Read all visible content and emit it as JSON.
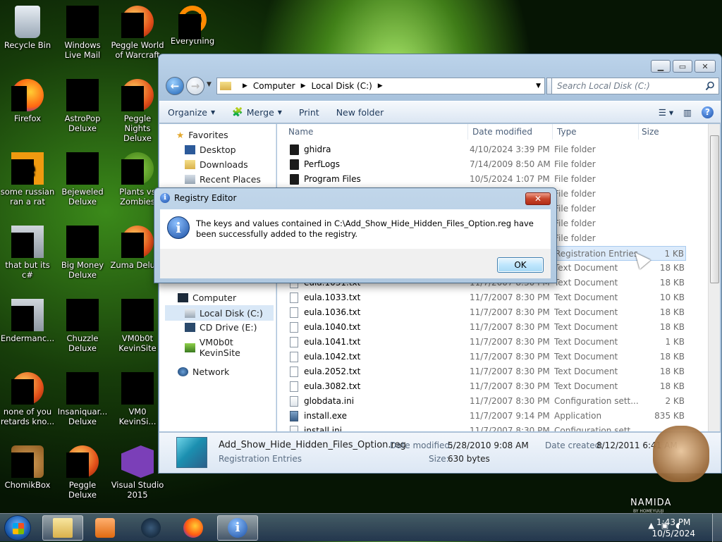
{
  "desktop": {
    "icons": [
      {
        "label": "Recycle Bin",
        "icon": "recycle-bin-icon"
      },
      {
        "label": "Windows Live Mail",
        "icon": "windows-live-mail-icon"
      },
      {
        "label": "Peggle World of Warcraft",
        "icon": "peggle-wow-icon"
      },
      {
        "label": "Everything",
        "icon": "everything-icon"
      },
      {
        "label": "Firefox",
        "icon": "firefox-icon"
      },
      {
        "label": "AstroPop Deluxe",
        "icon": "astropop-icon"
      },
      {
        "label": "Peggle Nights Deluxe",
        "icon": "peggle-nights-icon"
      },
      {
        "label": "some russian ran a rat",
        "icon": "e-app-icon"
      },
      {
        "label": "Bejeweled Deluxe",
        "icon": "bejeweled-icon"
      },
      {
        "label": "Plants vs Zombies",
        "icon": "plants-vs-zombies-icon"
      },
      {
        "label": "that but its c#",
        "icon": "windows-stack-icon"
      },
      {
        "label": "Big Money Deluxe",
        "icon": "big-money-icon"
      },
      {
        "label": "Zuma Deluxe",
        "icon": "zuma-icon"
      },
      {
        "label": "Endermanc...",
        "icon": "window-app-icon"
      },
      {
        "label": "Chuzzle Deluxe",
        "icon": "chuzzle-icon"
      },
      {
        "label": "VM0b0t KevinSite",
        "icon": "vm-globe-icon"
      },
      {
        "label": "none of you retards kno...",
        "icon": "red-ball-icon"
      },
      {
        "label": "Insaniquar... Deluxe",
        "icon": "insaniquarium-icon"
      },
      {
        "label": "VM0 KevinSi...",
        "icon": "vm-folder-icon"
      },
      {
        "label": "ChomikBox",
        "icon": "chomikbox-icon"
      },
      {
        "label": "Peggle Deluxe",
        "icon": "peggle-deluxe-icon"
      },
      {
        "label": "Visual Studio 2015",
        "icon": "visual-studio-icon"
      }
    ]
  },
  "explorer": {
    "address": {
      "seg1": "Computer",
      "seg2": "Local Disk (C:)"
    },
    "search_placeholder": "Search Local Disk (C:)",
    "toolbar": {
      "organize": "Organize",
      "merge": "Merge",
      "print": "Print",
      "new_folder": "New folder"
    },
    "nav": {
      "favorites": "Favorites",
      "desktop": "Desktop",
      "downloads": "Downloads",
      "recent": "Recent Places",
      "computer": "Computer",
      "local_disk": "Local Disk (C:)",
      "cd_drive": "CD Drive (E:)",
      "vm": "VM0b0t KevinSite",
      "network": "Network"
    },
    "columns": {
      "name": "Name",
      "date": "Date modified",
      "type": "Type",
      "size": "Size"
    },
    "rows": [
      {
        "name": "ghidra",
        "date": "4/10/2024 3:39 PM",
        "type": "File folder",
        "size": "",
        "kind": "folder"
      },
      {
        "name": "PerfLogs",
        "date": "7/14/2009 8:50 AM",
        "type": "File folder",
        "size": "",
        "kind": "folder"
      },
      {
        "name": "Program Files",
        "date": "10/5/2024 1:07 PM",
        "type": "File folder",
        "size": "",
        "kind": "folder"
      },
      {
        "name": "",
        "date": "",
        "type": "File folder",
        "size": "",
        "kind": "folder"
      },
      {
        "name": "",
        "date": "",
        "type": "File folder",
        "size": "",
        "kind": "folder"
      },
      {
        "name": "",
        "date": "",
        "type": "File folder",
        "size": "",
        "kind": "folder"
      },
      {
        "name": "",
        "date": "",
        "type": "File folder",
        "size": "",
        "kind": "folder"
      },
      {
        "name": "",
        "date": "",
        "type": "Registration Entries",
        "size": "1 KB",
        "kind": "reg"
      },
      {
        "name": "",
        "date": "",
        "type": "Text Document",
        "size": "18 KB",
        "kind": "txt"
      },
      {
        "name": "eula.1031.txt",
        "date": "11/7/2007 8:30 PM",
        "type": "Text Document",
        "size": "18 KB",
        "kind": "txt"
      },
      {
        "name": "eula.1033.txt",
        "date": "11/7/2007 8:30 PM",
        "type": "Text Document",
        "size": "10 KB",
        "kind": "txt"
      },
      {
        "name": "eula.1036.txt",
        "date": "11/7/2007 8:30 PM",
        "type": "Text Document",
        "size": "18 KB",
        "kind": "txt"
      },
      {
        "name": "eula.1040.txt",
        "date": "11/7/2007 8:30 PM",
        "type": "Text Document",
        "size": "18 KB",
        "kind": "txt"
      },
      {
        "name": "eula.1041.txt",
        "date": "11/7/2007 8:30 PM",
        "type": "Text Document",
        "size": "1 KB",
        "kind": "txt"
      },
      {
        "name": "eula.1042.txt",
        "date": "11/7/2007 8:30 PM",
        "type": "Text Document",
        "size": "18 KB",
        "kind": "txt"
      },
      {
        "name": "eula.2052.txt",
        "date": "11/7/2007 8:30 PM",
        "type": "Text Document",
        "size": "18 KB",
        "kind": "txt"
      },
      {
        "name": "eula.3082.txt",
        "date": "11/7/2007 8:30 PM",
        "type": "Text Document",
        "size": "18 KB",
        "kind": "txt"
      },
      {
        "name": "globdata.ini",
        "date": "11/7/2007 8:30 PM",
        "type": "Configuration sett...",
        "size": "2 KB",
        "kind": "ini"
      },
      {
        "name": "install.exe",
        "date": "11/7/2007 9:14 PM",
        "type": "Application",
        "size": "835 KB",
        "kind": "exe"
      },
      {
        "name": "install.ini",
        "date": "11/7/2007 8:30 PM",
        "type": "Configuration sett...",
        "size": "",
        "kind": "ini"
      }
    ],
    "details": {
      "filename": "Add_Show_Hide_Hidden_Files_Option.reg",
      "filetype": "Registration Entries",
      "modified_label": "Date modified:",
      "modified_value": "5/28/2010 9:08 AM",
      "created_label": "Date created:",
      "created_value": "8/12/2011 6:41 AM",
      "size_label": "Size:",
      "size_value": "630 bytes"
    }
  },
  "dialog": {
    "title": "Registry Editor",
    "message": "The keys and values contained in C:\\Add_Show_Hide_Hidden_Files_Option.reg have been successfully added to the registry.",
    "ok": "OK",
    "close": "✕"
  },
  "taskbar": {
    "time": "1:43 PM",
    "date": "10/5/2024"
  },
  "watermark": {
    "brand": "NAMIDA",
    "sub": "BY HOMEYUUJI"
  }
}
